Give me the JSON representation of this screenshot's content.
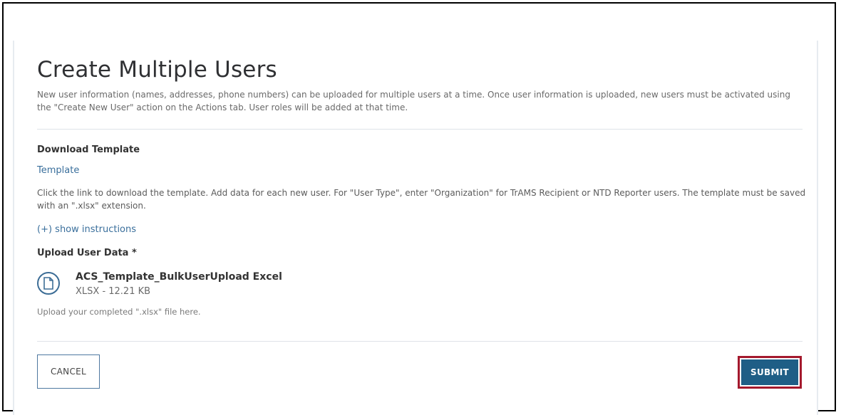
{
  "dialog": {
    "title": "Create Multiple Users",
    "description": "New user information (names, addresses, phone numbers) can be uploaded for multiple users at a time. Once user information is uploaded, new users must be activated using the \"Create New User\" action on the Actions tab. User roles will be added at that time."
  },
  "download": {
    "heading": "Download Template",
    "template_link": "Template",
    "help_text": "Click the link to download the template. Add data for each new user. For \"User Type\", enter \"Organization\" for TrAMS Recipient or NTD Reporter users. The template must be saved with an \".xlsx\" extension.",
    "instructions_toggle": "(+) show instructions"
  },
  "upload": {
    "heading": "Upload User Data *",
    "file_name": "ACS_Template_BulkUserUpload Excel",
    "file_meta": "XLSX  -  12.21 KB",
    "file_icon": "document-icon",
    "help_text": "Upload your completed \".xlsx\" file here."
  },
  "actions": {
    "cancel_label": "CANCEL",
    "submit_label": "SUBMIT",
    "submit_highlight_color": "#a4192d",
    "submit_color": "#1f5e86"
  }
}
